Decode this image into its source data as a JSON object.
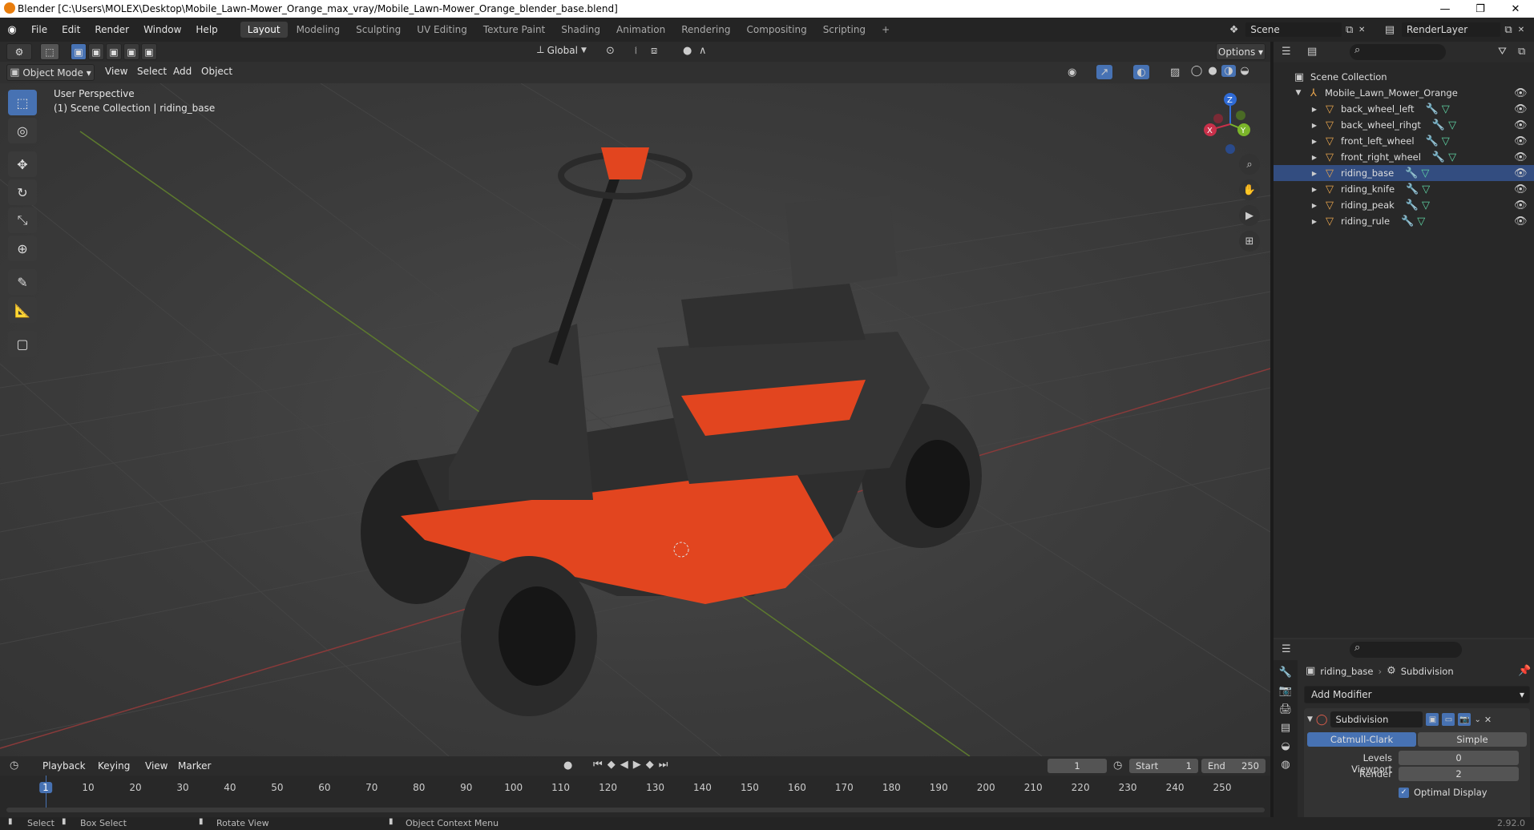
{
  "window": {
    "title": "Blender [C:\\Users\\MOLEX\\Desktop\\Mobile_Lawn-Mower_Orange_max_vray/Mobile_Lawn-Mower_Orange_blender_base.blend]"
  },
  "menu": [
    "File",
    "Edit",
    "Render",
    "Window",
    "Help"
  ],
  "workspaces": [
    "Layout",
    "Modeling",
    "Sculpting",
    "UV Editing",
    "Texture Paint",
    "Shading",
    "Animation",
    "Rendering",
    "Compositing",
    "Scripting"
  ],
  "active_workspace": "Layout",
  "scene": {
    "name": "Scene",
    "render_layer": "RenderLayer"
  },
  "toolbar": {
    "transform_orientation": "Global",
    "options_label": "Options"
  },
  "viewport_header": {
    "mode": "Object Mode",
    "menus": [
      "View",
      "Select",
      "Add",
      "Object"
    ]
  },
  "viewport": {
    "perspective_label": "User Perspective",
    "collection_label": "(1) Scene Collection | riding_base"
  },
  "gizmo": {
    "x": "X",
    "y": "Y",
    "z": "Z"
  },
  "outliner": {
    "root": "Scene Collection",
    "collection": "Mobile_Lawn_Mower_Orange",
    "objects": [
      "back_wheel_left",
      "back_wheel_rihgt",
      "front_left_wheel",
      "front_right_wheel",
      "riding_base",
      "riding_knife",
      "riding_peak",
      "riding_rule"
    ]
  },
  "properties": {
    "object_name": "riding_base",
    "modifier_tab": "Subdivision",
    "add_modifier": "Add Modifier",
    "modifier_name": "Subdivision",
    "algorithms": [
      "Catmull-Clark",
      "Simple"
    ],
    "active_algorithm": "Catmull-Clark",
    "levels_viewport_label": "Levels Viewport",
    "levels_viewport_value": "0",
    "render_label": "Render",
    "render_value": "2",
    "optimal_display": "Optimal Display"
  },
  "timeline": {
    "menus": [
      "Playback",
      "Keying",
      "View",
      "Marker"
    ],
    "current_frame": "1",
    "start_label": "Start",
    "start_value": "1",
    "end_label": "End",
    "end_value": "250",
    "ticks": [
      "1",
      "10",
      "20",
      "30",
      "40",
      "50",
      "60",
      "70",
      "80",
      "90",
      "100",
      "110",
      "120",
      "130",
      "140",
      "150",
      "160",
      "170",
      "180",
      "190",
      "200",
      "210",
      "220",
      "230",
      "240",
      "250"
    ]
  },
  "statusbar": {
    "select": "Select",
    "box_select": "Box Select",
    "rotate_view": "Rotate View",
    "context_menu": "Object Context Menu",
    "version": "2.92.0"
  }
}
